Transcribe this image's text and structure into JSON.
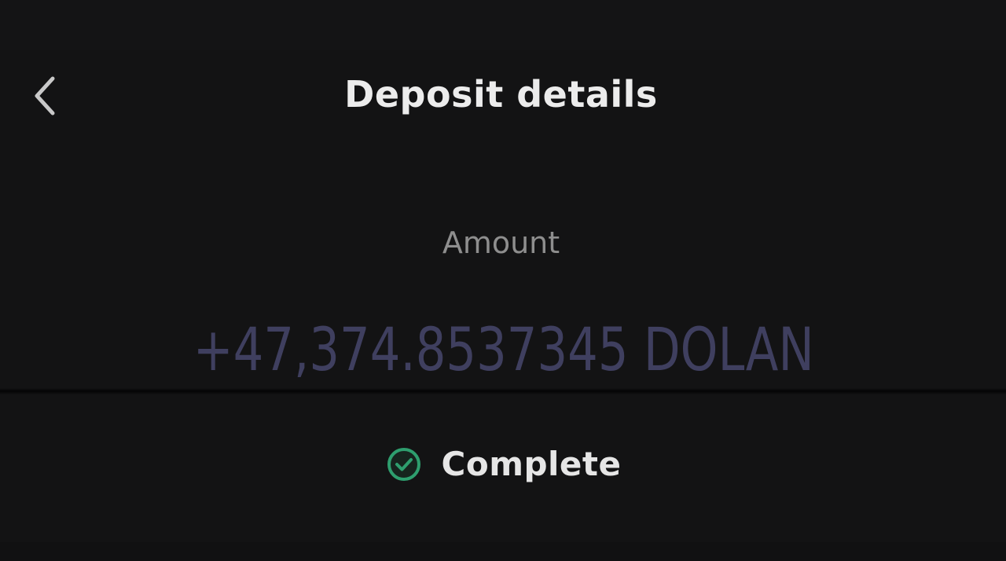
{
  "header": {
    "title": "Deposit details",
    "back_icon": "chevron-left-icon"
  },
  "deposit": {
    "amount_label": "Amount",
    "amount_value": "+47,374.8537345 DOLAN",
    "status": "Complete",
    "status_icon": "check-circle-icon"
  },
  "colors": {
    "background": "#131314",
    "title": "#ececec",
    "label": "#8e8e8e",
    "amount": "#3f3f5f",
    "status_accent": "#2e9e6e"
  }
}
